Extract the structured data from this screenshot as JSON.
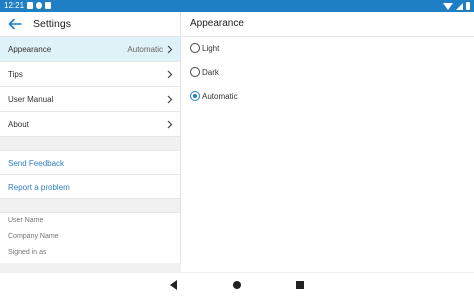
{
  "status_bar": {
    "time": "12:21"
  },
  "settings_panel": {
    "title": "Settings",
    "menu": [
      {
        "label": "Appearance",
        "value": "Automatic"
      },
      {
        "label": "Tips",
        "value": ""
      },
      {
        "label": "User Manual",
        "value": ""
      },
      {
        "label": "About",
        "value": ""
      }
    ],
    "links": [
      {
        "label": "Send Feedback"
      },
      {
        "label": "Report a problem"
      }
    ],
    "account_info": [
      {
        "label": "User Name"
      },
      {
        "label": "Company Name"
      },
      {
        "label": "Signed in as"
      }
    ]
  },
  "appearance_panel": {
    "title": "Appearance",
    "options": [
      {
        "label": "Light",
        "selected": false
      },
      {
        "label": "Dark",
        "selected": false
      },
      {
        "label": "Automatic",
        "selected": true
      }
    ]
  },
  "colors": {
    "accent": "#1f7fc4",
    "selected_row": "#dff2f8",
    "link": "#2d7fc1"
  },
  "icons": {
    "back": "arrow-left-icon",
    "chevron": "chevron-right-icon",
    "nav_back": "triangle-back-icon",
    "nav_home": "circle-home-icon",
    "nav_recent": "square-recents-icon"
  }
}
